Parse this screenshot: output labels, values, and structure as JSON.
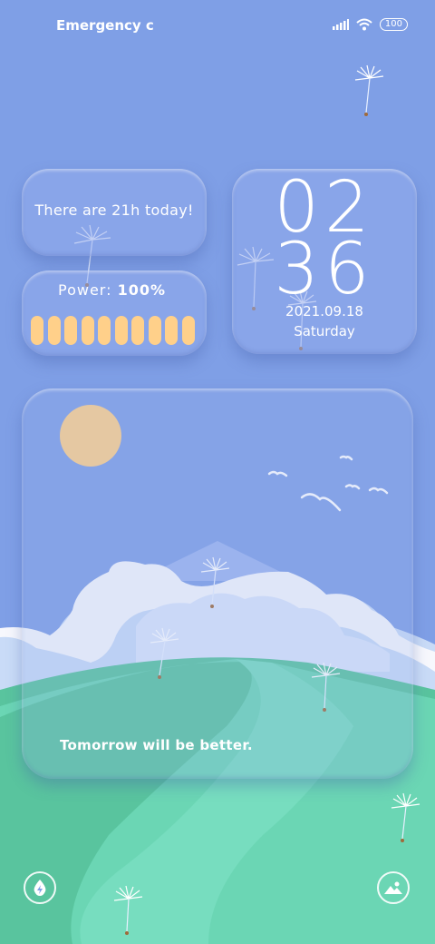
{
  "status_bar": {
    "carrier_text": "Emergency c",
    "battery_level": "100",
    "signal_icon": "signal-bars-icon",
    "wifi_icon": "wifi-icon"
  },
  "widgets": {
    "hours_text": "There are 21h today!",
    "power_label": "Power:",
    "power_value": "100%",
    "power_level_fraction": 1.0,
    "power_segments": 10,
    "clock_hour": "02",
    "clock_minute": "36",
    "date": "2021.09.18",
    "weekday": "Saturday"
  },
  "scene": {
    "quote": "Tomorrow will be better."
  },
  "bottom_bar": {
    "left_icon": "flashlight-icon",
    "right_icon": "gallery-icon"
  },
  "colors": {
    "background": "#7f9fe6",
    "sun": "#ffd08a",
    "grass": "#6bd6b4",
    "battery_bar": "#ffd08a"
  }
}
